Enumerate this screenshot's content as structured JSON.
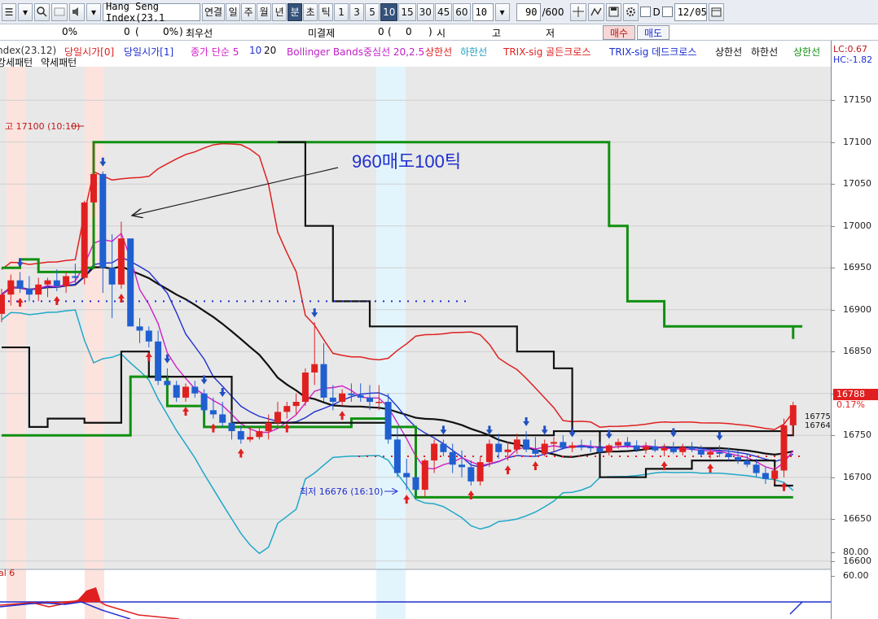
{
  "toolbar": {
    "menu_glyph": "☰",
    "symbol_input": "Hang Seng Index(23.1",
    "buttons": [
      "연결",
      "일",
      "주",
      "월",
      "년",
      "분",
      "초",
      "틱",
      "1",
      "3",
      "5",
      "10",
      "15",
      "30",
      "45",
      "60"
    ],
    "active_buttons": [
      "분",
      "10"
    ],
    "period_value": "10",
    "count_value": "90",
    "count_total": "/600",
    "d_label": "D",
    "date_value": "12/05"
  },
  "info_row": {
    "pct": "0%",
    "qty": "0",
    "paren_open": "(",
    "paren_pct": "0%",
    "paren_close": ")",
    "best_label": "최우선",
    "unsettled_label": "미결제",
    "unsettled_qty": "0",
    "unsettled_open": "(",
    "unsettled_inner": "0",
    "unsettled_close": ")",
    "market": [
      "시",
      "고",
      "저"
    ],
    "buy_label": "매수",
    "sell_label": "매도"
  },
  "legend": {
    "row1": [
      {
        "text": "ndex(23.12)",
        "color": "#333333"
      },
      {
        "text": "당일시가[0]",
        "color": "#e02020"
      },
      {
        "text": "당일시가[1]",
        "color": "#1f2fd0"
      },
      {
        "text": "종가 단순 5",
        "color": "#d020c8"
      },
      {
        "text": "10",
        "color": "#1f2fd0"
      },
      {
        "text": "20",
        "color": "#111111"
      },
      {
        "text": "Bollinger Bands중심선 20,2.5",
        "color": "#c020c8"
      },
      {
        "text": "상한선",
        "color": "#e02020"
      },
      {
        "text": "하한선",
        "color": "#20a0c0"
      },
      {
        "text": "TRIX-sig 골든크로스",
        "color": "#e02020"
      },
      {
        "text": "TRIX-sig 데드크로스",
        "color": "#1f2fd0"
      },
      {
        "text": "상한선",
        "color": "#111111"
      },
      {
        "text": "하한선",
        "color": "#111111"
      },
      {
        "text": "상한선",
        "color": "#109010"
      }
    ],
    "row2": [
      {
        "text": "강세패턴",
        "color": "#111111"
      },
      {
        "text": "약세패턴",
        "color": "#111111"
      }
    ],
    "lc": "LC:0.67",
    "hc": "HC:-1.82"
  },
  "chart_data": {
    "type": "candlestick",
    "series_name": "Hang Seng Index",
    "interval": "10분",
    "ylim": [
      16590,
      17190
    ],
    "yticks": [
      16600,
      16650,
      16700,
      16750,
      16800,
      16850,
      16900,
      16950,
      17000,
      17050,
      17100,
      17150
    ],
    "candles": [
      [
        16895,
        16925,
        16885,
        16918
      ],
      [
        16918,
        16942,
        16905,
        16935
      ],
      [
        16935,
        16945,
        16920,
        16925
      ],
      [
        16925,
        16940,
        16910,
        16918
      ],
      [
        16918,
        16938,
        16910,
        16930
      ],
      [
        16930,
        16938,
        16915,
        16935
      ],
      [
        16935,
        16948,
        16922,
        16928
      ],
      [
        16928,
        16945,
        16920,
        16940
      ],
      [
        16940,
        16955,
        16930,
        16938
      ],
      [
        16938,
        17030,
        16930,
        17028
      ],
      [
        17028,
        17100,
        17010,
        17062
      ],
      [
        17062,
        17065,
        16920,
        16950
      ],
      [
        16950,
        16990,
        16890,
        16930
      ],
      [
        16930,
        17005,
        16925,
        16985
      ],
      [
        16985,
        16985,
        16880,
        16880
      ],
      [
        16880,
        16890,
        16860,
        16875
      ],
      [
        16875,
        16880,
        16855,
        16862
      ],
      [
        16862,
        16875,
        16810,
        16815
      ],
      [
        16815,
        16830,
        16800,
        16810
      ],
      [
        16810,
        16815,
        16790,
        16795
      ],
      [
        16795,
        16812,
        16790,
        16808
      ],
      [
        16808,
        16815,
        16795,
        16800
      ],
      [
        16800,
        16805,
        16775,
        16780
      ],
      [
        16780,
        16795,
        16770,
        16775
      ],
      [
        16775,
        16790,
        16760,
        16765
      ],
      [
        16765,
        16780,
        16745,
        16755
      ],
      [
        16755,
        16762,
        16740,
        16745
      ],
      [
        16745,
        16760,
        16742,
        16748
      ],
      [
        16748,
        16760,
        16745,
        16755
      ],
      [
        16755,
        16775,
        16745,
        16765
      ],
      [
        16765,
        16790,
        16760,
        16778
      ],
      [
        16778,
        16790,
        16770,
        16785
      ],
      [
        16785,
        16800,
        16775,
        16790
      ],
      [
        16790,
        16830,
        16785,
        16825
      ],
      [
        16825,
        16885,
        16810,
        16835
      ],
      [
        16835,
        16860,
        16790,
        16795
      ],
      [
        16795,
        16810,
        16780,
        16790
      ],
      [
        16790,
        16805,
        16785,
        16800
      ],
      [
        16800,
        16812,
        16790,
        16798
      ],
      [
        16798,
        16812,
        16790,
        16795
      ],
      [
        16795,
        16810,
        16780,
        16790
      ],
      [
        16790,
        16810,
        16780,
        16790
      ],
      [
        16790,
        16800,
        16740,
        16745
      ],
      [
        16745,
        16760,
        16700,
        16705
      ],
      [
        16705,
        16722,
        16685,
        16700
      ],
      [
        16700,
        16720,
        16680,
        16685
      ],
      [
        16685,
        16722,
        16676,
        16720
      ],
      [
        16720,
        16745,
        16705,
        16740
      ],
      [
        16740,
        16745,
        16725,
        16730
      ],
      [
        16730,
        16740,
        16705,
        16715
      ],
      [
        16715,
        16732,
        16700,
        16712
      ],
      [
        16712,
        16720,
        16690,
        16695
      ],
      [
        16695,
        16725,
        16690,
        16718
      ],
      [
        16718,
        16745,
        16712,
        16740
      ],
      [
        16740,
        16752,
        16722,
        16730
      ],
      [
        16730,
        16742,
        16720,
        16733
      ],
      [
        16733,
        16752,
        16728,
        16745
      ],
      [
        16745,
        16755,
        16730,
        16733
      ],
      [
        16733,
        16748,
        16725,
        16728
      ],
      [
        16728,
        16745,
        16725,
        16740
      ],
      [
        16740,
        16748,
        16730,
        16742
      ],
      [
        16742,
        16750,
        16733,
        16735
      ],
      [
        16735,
        16742,
        16730,
        16738
      ],
      [
        16738,
        16745,
        16732,
        16736
      ],
      [
        16736,
        16744,
        16730,
        16735
      ],
      [
        16735,
        16742,
        16728,
        16730
      ],
      [
        16730,
        16740,
        16726,
        16738
      ],
      [
        16738,
        16746,
        16734,
        16742
      ],
      [
        16742,
        16748,
        16735,
        16738
      ],
      [
        16738,
        16744,
        16730,
        16733
      ],
      [
        16733,
        16742,
        16728,
        16737
      ],
      [
        16737,
        16745,
        16730,
        16732
      ],
      [
        16732,
        16740,
        16725,
        16735
      ],
      [
        16735,
        16742,
        16728,
        16730
      ],
      [
        16730,
        16740,
        16726,
        16736
      ],
      [
        16736,
        16742,
        16730,
        16733
      ],
      [
        16733,
        16738,
        16725,
        16727
      ],
      [
        16727,
        16734,
        16722,
        16730
      ],
      [
        16730,
        16738,
        16724,
        16728
      ],
      [
        16728,
        16735,
        16720,
        16724
      ],
      [
        16724,
        16732,
        16716,
        16720
      ],
      [
        16720,
        16728,
        16712,
        16715
      ],
      [
        16715,
        16722,
        16700,
        16705
      ],
      [
        16705,
        16712,
        16692,
        16698
      ],
      [
        16698,
        16712,
        16692,
        16708
      ],
      [
        16708,
        16770,
        16700,
        16762
      ],
      [
        16762,
        16790,
        16750,
        16786
      ]
    ],
    "annotations": {
      "high": "고 17100 (10:10)",
      "low": "최저 16676 (16:10)",
      "note": "960매도100틱"
    },
    "current_price": "16788",
    "current_change": "0.17%",
    "last_labels": [
      "16775",
      "16764"
    ]
  },
  "sub_panel": {
    "label": "al 6",
    "ticks": [
      "80.00",
      "60.00"
    ]
  }
}
